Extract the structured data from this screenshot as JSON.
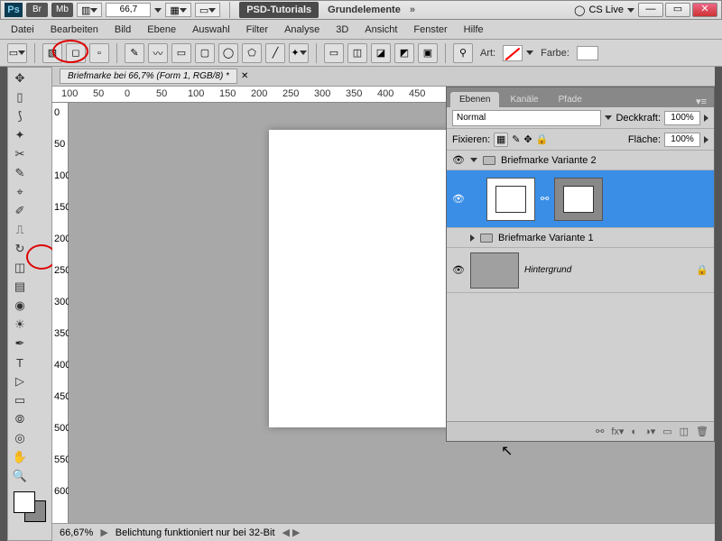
{
  "titlebar": {
    "ps": "Ps",
    "br": "Br",
    "mb": "Mb",
    "zoom": "66,7",
    "psd_tut": "PSD-Tutorials",
    "grund": "Grundelemente",
    "cslive": "CS Live"
  },
  "menu": [
    "Datei",
    "Bearbeiten",
    "Bild",
    "Ebene",
    "Auswahl",
    "Filter",
    "Analyse",
    "3D",
    "Ansicht",
    "Fenster",
    "Hilfe"
  ],
  "options": {
    "art": "Art:",
    "farbe": "Farbe:"
  },
  "doc": {
    "tab": "Briefmarke bei 66,7% (Form 1, RGB/8) *",
    "ruler_marks": [
      "100",
      "50",
      "0",
      "50",
      "100",
      "150",
      "200",
      "250",
      "300",
      "350",
      "400",
      "450"
    ],
    "ruler_v": [
      "0",
      "50",
      "100",
      "150",
      "200",
      "250",
      "300",
      "350",
      "400",
      "450",
      "500",
      "550",
      "600"
    ]
  },
  "panel": {
    "tabs": [
      "Ebenen",
      "Kanäle",
      "Pfade"
    ],
    "blend": "Normal",
    "deck": "Deckkraft:",
    "deck_val": "100%",
    "fix": "Fixieren:",
    "flache": "Fläche:",
    "flache_val": "100%",
    "group2": "Briefmarke Variante 2",
    "group1": "Briefmarke Variante 1",
    "bg": "Hintergrund"
  },
  "status": {
    "zoom": "66,67%",
    "msg": "Belichtung funktioniert nur bei 32-Bit"
  }
}
